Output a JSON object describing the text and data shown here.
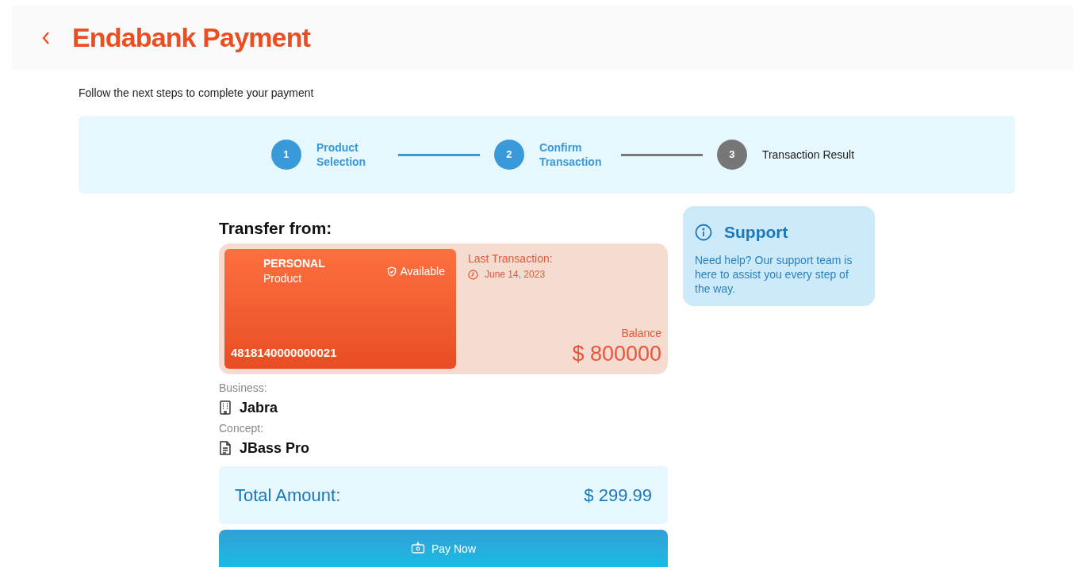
{
  "header": {
    "title": "Endabank Payment"
  },
  "intro": "Follow the next steps to complete your payment",
  "steps": [
    {
      "number": "1",
      "label": "Product Selection",
      "done": true
    },
    {
      "number": "2",
      "label": "Confirm Transaction",
      "done": true
    },
    {
      "number": "3",
      "label": "Transaction Result",
      "done": false
    }
  ],
  "transfer": {
    "heading": "Transfer from:",
    "card": {
      "type": "PERSONAL",
      "subtitle": "Product",
      "status": "Available",
      "number": "4818140000000021"
    },
    "last_transaction_label": "Last Transaction:",
    "last_transaction_date": "June 14, 2023",
    "balance_label": "Balance",
    "balance": "$ 800000"
  },
  "details": [
    {
      "label": "Business:",
      "value": "Jabra",
      "kind": "business"
    },
    {
      "label": "Concept:",
      "value": "JBass Pro",
      "kind": "concept"
    }
  ],
  "total": {
    "label": "Total Amount:",
    "value": "$ 299.99"
  },
  "pay_button": "Pay Now",
  "support": {
    "title": "Support",
    "text": "Need help? Our support team is here to assist you every step of the way."
  }
}
